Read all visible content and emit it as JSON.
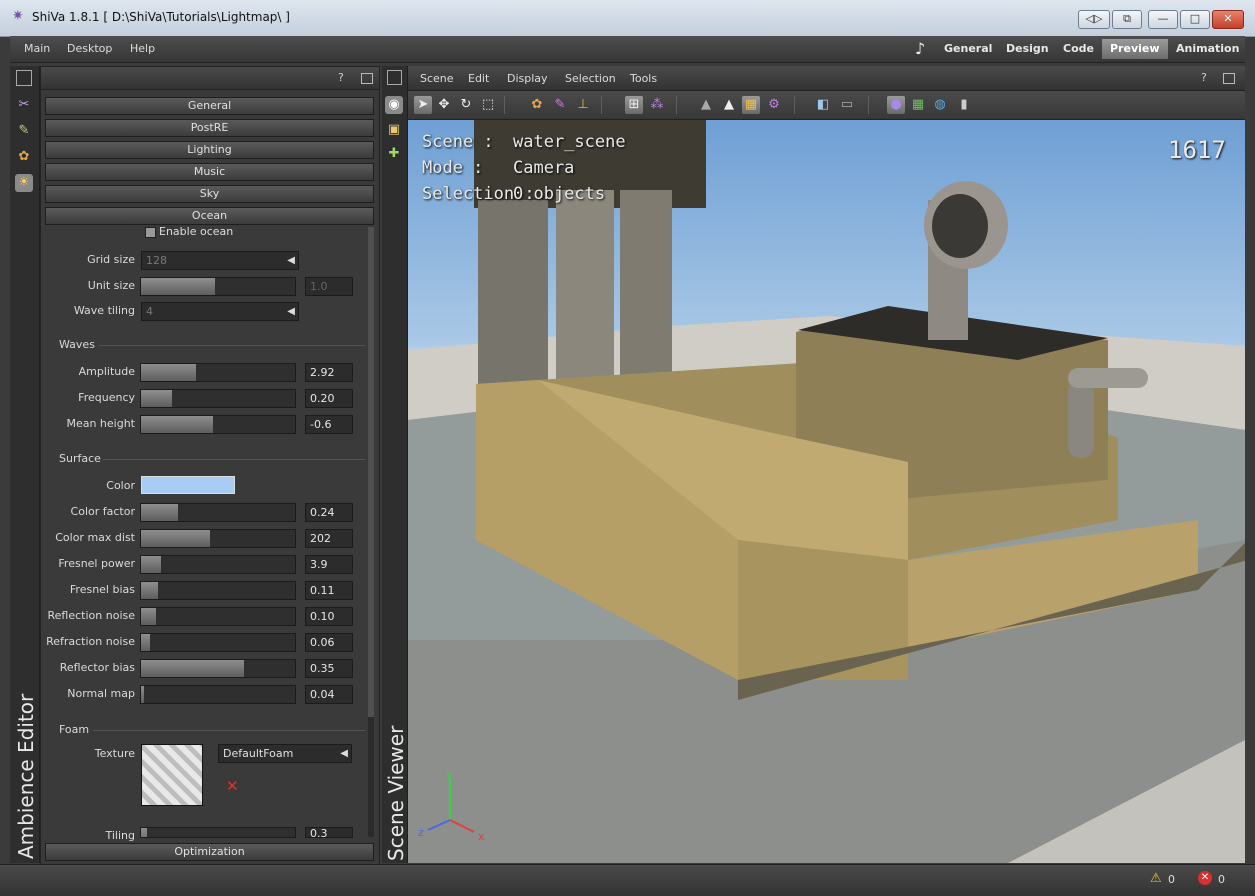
{
  "window": {
    "title": "ShiVa 1.8.1 [ D:\\ShiVa\\Tutorials\\Lightmap\\ ]",
    "buttons": {
      "nav": "◁▷",
      "restore_app": "⧉",
      "minimize": "—",
      "maximize": "□",
      "close": "✕"
    }
  },
  "menubar": {
    "items": [
      "Main",
      "Desktop",
      "Help"
    ],
    "music_icon": "♪",
    "modes": [
      "General",
      "Design",
      "Code",
      "Preview",
      "Animation"
    ],
    "active_mode": "Preview"
  },
  "left_strip": {
    "panel_title": "Ambience Editor",
    "icons": [
      "wrench-icon",
      "pin-icon",
      "palette-icon",
      "sky-icon"
    ]
  },
  "ambience": {
    "help": "?",
    "sections": [
      "General",
      "PostRE",
      "Lighting",
      "Music",
      "Sky",
      "Ocean"
    ],
    "enable_ocean": "Enable ocean",
    "grid_size": {
      "label": "Grid size",
      "value": "128"
    },
    "unit_size": {
      "label": "Unit size",
      "value": "1.0",
      "fill": 0.48
    },
    "wave_tiling": {
      "label": "Wave tiling",
      "value": "4"
    },
    "waves_title": "Waves",
    "waves": [
      {
        "label": "Amplitude",
        "value": "2.92",
        "fill": 0.36
      },
      {
        "label": "Frequency",
        "value": "0.20",
        "fill": 0.2
      },
      {
        "label": "Mean height",
        "value": "-0.6",
        "fill": 0.47
      }
    ],
    "surface_title": "Surface",
    "surface_color": {
      "label": "Color",
      "hex": "#a8cdf5"
    },
    "surface": [
      {
        "label": "Color factor",
        "value": "0.24",
        "fill": 0.24
      },
      {
        "label": "Color max dist",
        "value": "202",
        "fill": 0.45
      },
      {
        "label": "Fresnel power",
        "value": "3.9",
        "fill": 0.13
      },
      {
        "label": "Fresnel bias",
        "value": "0.11",
        "fill": 0.11
      },
      {
        "label": "Reflection noise",
        "value": "0.10",
        "fill": 0.1
      },
      {
        "label": "Refraction noise",
        "value": "0.06",
        "fill": 0.06
      },
      {
        "label": "Reflector bias",
        "value": "0.35",
        "fill": 0.67
      },
      {
        "label": "Normal map",
        "value": "0.04",
        "fill": 0.02
      }
    ],
    "foam_title": "Foam",
    "texture_label": "Texture",
    "texture_value": "DefaultFoam",
    "tiling": {
      "label": "Tiling",
      "value": "0.3",
      "fill": 0.04
    },
    "optimization": "Optimization"
  },
  "viewer": {
    "title": "Scene Viewer",
    "help": "?",
    "menu": [
      "Scene",
      "Edit",
      "Display",
      "Selection",
      "Tools"
    ],
    "scene_label": "Scene :",
    "scene_value": "water_scene",
    "mode_label": "Mode :",
    "mode_value": "Camera",
    "selection_label": "Selection :",
    "selection_value": "0 objects",
    "fps": "1617",
    "axes": {
      "x": "x",
      "y": "y",
      "z": "z"
    }
  },
  "status": {
    "warnings": "0",
    "errors": "0"
  }
}
